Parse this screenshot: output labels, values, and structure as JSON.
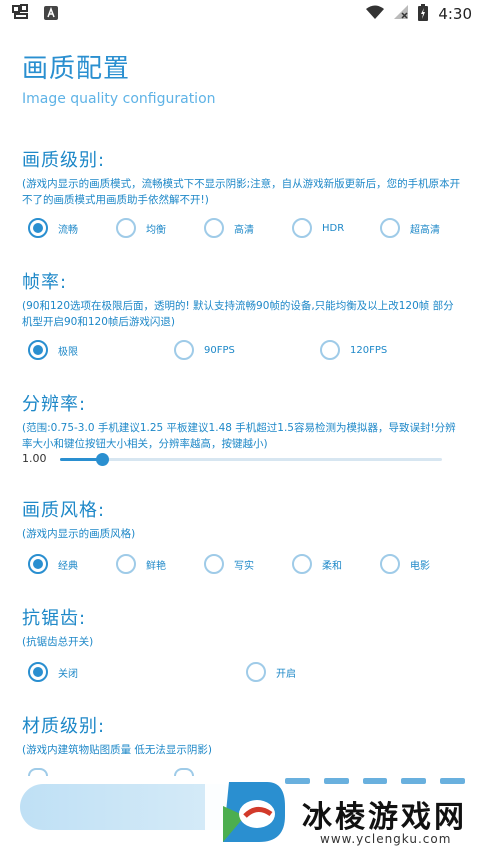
{
  "status_bar": {
    "time": "4:30",
    "icons": [
      "bug-icon",
      "app-a-icon",
      "wifi-icon",
      "no-sim-icon",
      "battery-charging-icon"
    ]
  },
  "header": {
    "title": "画质配置",
    "subtitle": "Image quality configuration"
  },
  "sections": {
    "quality": {
      "title": "画质级别:",
      "desc": "(游戏内显示的画质模式，流畅模式下不显示阴影;注意，自从游戏新版更新后，您的手机原本开不了的画质模式用画质助手依然解不开!)",
      "options": [
        "流畅",
        "均衡",
        "高清",
        "HDR",
        "超高清"
      ],
      "selected": "流畅"
    },
    "framerate": {
      "title": "帧率:",
      "desc": "(90和120选项在极限后面，透明的! 默认支持流畅90帧的设备,只能均衡及以上改120帧 部分机型开启90和120帧后游戏闪退)",
      "options": [
        "极限",
        "90FPS",
        "120FPS"
      ],
      "selected": "极限"
    },
    "resolution": {
      "title": "分辨率:",
      "desc": "(范围:0.75-3.0 手机建议1.25 平板建议1.48 手机超过1.5容易检测为模拟器，导致误封!分辨率大小和键位按钮大小相关，分辨率越高，按键越小)",
      "value_label": "1.00",
      "range": [
        0.75,
        3.0
      ],
      "value": 1.0
    },
    "style": {
      "title": "画质风格:",
      "desc": "(游戏内显示的画质风格)",
      "options": [
        "经典",
        "鲜艳",
        "写实",
        "柔和",
        "电影"
      ],
      "selected": "经典"
    },
    "antialias": {
      "title": "抗锯齿:",
      "desc": "(抗锯齿总开关)",
      "options": [
        "关闭",
        "开启"
      ],
      "selected": "关闭"
    },
    "material": {
      "title": "材质级别:",
      "desc": "(游戏内建筑物贴图质量 低无法显示阴影)"
    }
  },
  "watermark": {
    "name": "冰棱游戏网",
    "url": "www.yclengku.com"
  },
  "colors": {
    "accent": "#2a8fd0",
    "radio_idle": "#9fcbe8",
    "button": "#cfe7f6"
  }
}
